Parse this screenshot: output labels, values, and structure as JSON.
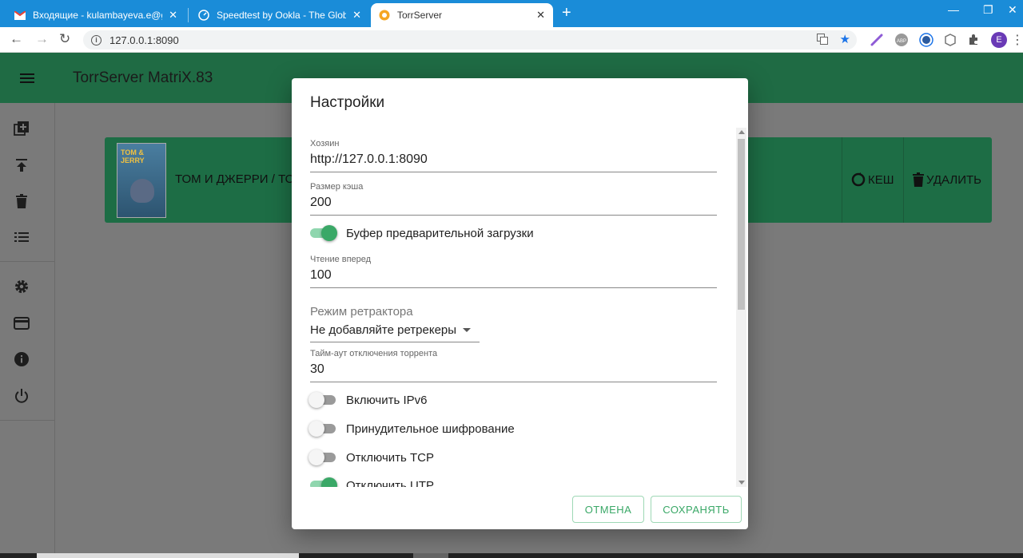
{
  "browser": {
    "tabs": [
      {
        "title": "Входящие - kulambayeva.e@gm",
        "favicon": "gmail-icon"
      },
      {
        "title": "Speedtest by Ookla - The Global",
        "favicon": "speedtest-icon"
      },
      {
        "title": "TorrServer",
        "favicon": "torrserver-icon"
      }
    ],
    "url": "127.0.0.1:8090",
    "profile_initial": "E",
    "abp_label": "ABP"
  },
  "app": {
    "title": "TorrServer MatriX.83",
    "card": {
      "title": "ТОМ И ДЖЕРРИ / ТО",
      "poster_text": "TOM & JERRY",
      "cache_label": "КЕШ",
      "delete_label": "УДАЛИТЬ"
    }
  },
  "dialog": {
    "title": "Настройки",
    "host": {
      "label": "Хозяин",
      "value": "http://127.0.0.1:8090"
    },
    "cache_size": {
      "label": "Размер кэша",
      "value": "200"
    },
    "preload_buffer": {
      "label": "Буфер предварительной загрузки",
      "on": true
    },
    "read_ahead": {
      "label": "Чтение вперед",
      "value": "100"
    },
    "retracker": {
      "label": "Режим ретрактора",
      "value": "Не добавляйте ретрекеры"
    },
    "timeout": {
      "label": "Тайм-аут отключения торрента",
      "value": "30"
    },
    "ipv6": {
      "label": "Включить IPv6",
      "on": false
    },
    "encryption": {
      "label": "Принудительное шифрование",
      "on": false
    },
    "disable_tcp": {
      "label": "Отключить TCP",
      "on": false
    },
    "disable_utp": {
      "label": "Отключить UTP",
      "on": true
    },
    "cancel_label": "ОТМЕНА",
    "save_label": "СОХРАНЯТЬ"
  },
  "colors": {
    "tabbar": "#1a8cd8",
    "appbar": "#1f6b44",
    "accent": "#3aa867",
    "backdrop": "#7a7a7a"
  }
}
